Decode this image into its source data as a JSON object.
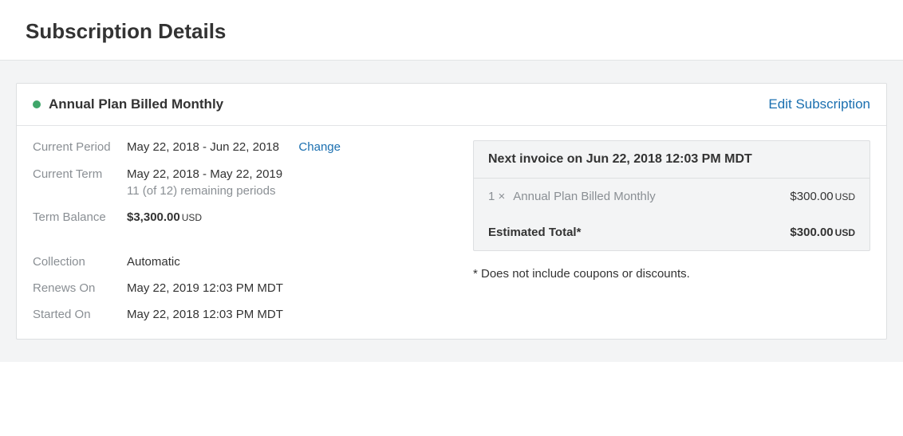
{
  "page": {
    "title": "Subscription Details"
  },
  "card": {
    "plan_name": "Annual Plan Billed Monthly",
    "status": "active",
    "edit_label": "Edit Subscription"
  },
  "details": {
    "current_period": {
      "label": "Current Period",
      "value": "May 22, 2018 - Jun 22, 2018",
      "action": "Change"
    },
    "current_term": {
      "label": "Current Term",
      "value": "May 22, 2018 - May 22, 2019",
      "sub": "11 (of 12) remaining periods"
    },
    "term_balance": {
      "label": "Term Balance",
      "amount": "$3,300.00",
      "currency": "USD"
    },
    "collection": {
      "label": "Collection",
      "value": "Automatic"
    },
    "renews_on": {
      "label": "Renews On",
      "value": "May 22, 2019 12:03 PM MDT"
    },
    "started_on": {
      "label": "Started On",
      "value": "May 22, 2018 12:03 PM MDT"
    }
  },
  "invoice": {
    "header": "Next invoice on Jun 22, 2018 12:03 PM MDT",
    "line": {
      "qty": "1 ×",
      "name": "Annual Plan Billed Monthly",
      "amount": "$300.00",
      "currency": "USD"
    },
    "total": {
      "label": "Estimated Total*",
      "amount": "$300.00",
      "currency": "USD"
    },
    "note": "* Does not include coupons or discounts."
  }
}
